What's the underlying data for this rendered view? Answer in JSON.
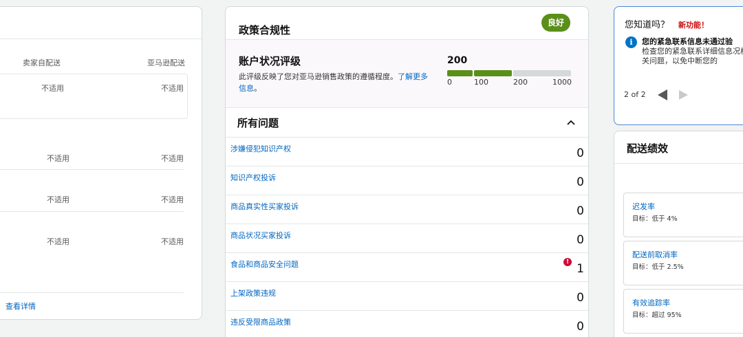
{
  "left": {
    "col_seller": "卖家自配送",
    "col_amazon": "亚马逊配送",
    "row1": {
      "seller": "不适用",
      "amazon": "不适用"
    },
    "row2": {
      "seller": "不适用",
      "amazon": "不适用"
    },
    "row3": {
      "seller": "不适用",
      "amazon": "不适用"
    },
    "row4": {
      "seller": "不适用",
      "amazon": "不适用"
    },
    "view_details": "查看详情"
  },
  "policy": {
    "title": "政策合规性",
    "badge": "良好",
    "badge_color": "#5a8f1a",
    "rating_title": "账户状况评级",
    "rating_desc": "此评级反映了您对亚马逊销售政策的遵循程度。",
    "rating_link": "了解更多信息",
    "rating_end": "。",
    "score": "200",
    "scale": [
      "0",
      "100",
      "200",
      "1000"
    ],
    "issues_header": "所有问题",
    "issues": [
      {
        "label": "涉嫌侵犯知识产权",
        "count": "0"
      },
      {
        "label": "知识产权投诉",
        "count": "0"
      },
      {
        "label": "商品真实性买家投诉",
        "count": "0"
      },
      {
        "label": "商品状况买家投诉",
        "count": "0"
      },
      {
        "label": "食品和商品安全问题",
        "count": "1",
        "alert": "!"
      },
      {
        "label": "上架政策违规",
        "count": "0"
      },
      {
        "label": "违反受限商品政策",
        "count": "0"
      }
    ]
  },
  "dyk": {
    "title": "您知道吗？",
    "new_label": "新功能！",
    "info_glyph": "i",
    "heading": "您的紧急联系信息未通过验",
    "body": "检查您的紧急联系详细信息况相关问题，以免中断您的",
    "pager": "2 of 2"
  },
  "shipping": {
    "title": "配送绩效",
    "metrics": [
      {
        "name": "迟发率",
        "target": "目标：低于 4%"
      },
      {
        "name": "配送前取消率",
        "target": "目标：低于 2.5%"
      },
      {
        "name": "有效追踪率",
        "target": "目标：超过 95%"
      }
    ]
  }
}
